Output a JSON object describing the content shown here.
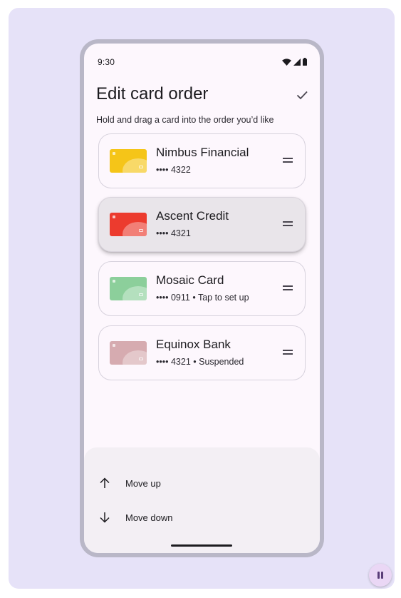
{
  "status_bar": {
    "time": "9:30"
  },
  "header": {
    "title": "Edit card order",
    "subtitle": "Hold and drag a card into the order you’d like"
  },
  "cards": [
    {
      "name": "Nimbus Financial",
      "detail": "•••• 4322",
      "color": "#f5c518",
      "state": "normal"
    },
    {
      "name": "Ascent Credit",
      "detail": "•••• 4321",
      "color": "#ec3b2e",
      "state": "dragging"
    },
    {
      "name": "Mosaic Card",
      "detail": "•••• 0911  • Tap to set up",
      "color": "#8ccf9b",
      "state": "normal"
    },
    {
      "name": "Equinox Bank",
      "detail": "•••• 4321  • Suspended",
      "color": "#d6abb0",
      "state": "normal"
    }
  ],
  "sheet": {
    "move_up": "Move up",
    "move_down": "Move down"
  },
  "icons": {
    "confirm": "check-icon",
    "drag": "drag-handle-icon",
    "up": "arrow-up-icon",
    "down": "arrow-down-icon",
    "wifi": "wifi-icon",
    "signal": "signal-icon",
    "battery": "battery-icon",
    "pause": "pause-icon"
  },
  "colors": {
    "backdrop": "#e6e2f8",
    "screen": "#fdf7fd",
    "accent": "#ead7f5"
  }
}
